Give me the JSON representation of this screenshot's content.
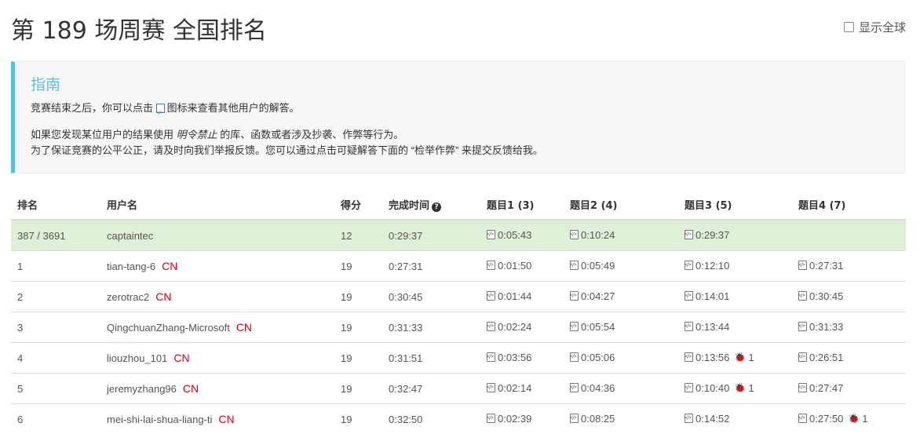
{
  "page": {
    "title": "第 189 场周赛 全国排名",
    "show_global_label": "显示全球"
  },
  "guide": {
    "heading": "指南",
    "line1_pre": "竞赛结束之后，你可以点击",
    "line1_post": "图标来查看其他用户的解答。",
    "line2_pre": "如果您发现某位用户的结果使用",
    "line2_em": "明令禁止",
    "line2_post": "的库、函数或者涉及抄袭、作弊等行为。",
    "line3": "为了保证竞赛的公平公正，请及时向我们举报反馈。您可以通过点击可疑解答下面的 “检举作弊” 来提交反馈给我。"
  },
  "table": {
    "headers": {
      "rank": "排名",
      "username": "用户名",
      "score": "得分",
      "finish_time": "完成时间",
      "q1": "题目1 (3)",
      "q2": "题目2 (4)",
      "q3": "题目3 (5)",
      "q4": "题目4 (7)"
    },
    "rows": [
      {
        "rank": "387 / 3691",
        "user": "captaintec",
        "cn": "",
        "score": "12",
        "time": "0:29:37",
        "q1": "0:05:43",
        "q2": "0:10:24",
        "q3": "0:29:37",
        "q3_bug": "",
        "q4": "",
        "q4_bug": ""
      },
      {
        "rank": "1",
        "user": "tian-tang-6",
        "cn": "CN",
        "score": "19",
        "time": "0:27:31",
        "q1": "0:01:50",
        "q2": "0:05:49",
        "q3": "0:12:10",
        "q3_bug": "",
        "q4": "0:27:31",
        "q4_bug": ""
      },
      {
        "rank": "2",
        "user": "zerotrac2",
        "cn": "CN",
        "score": "19",
        "time": "0:30:45",
        "q1": "0:01:44",
        "q2": "0:04:27",
        "q3": "0:14:01",
        "q3_bug": "",
        "q4": "0:30:45",
        "q4_bug": ""
      },
      {
        "rank": "3",
        "user": "QingchuanZhang-Microsoft",
        "cn": "CN",
        "score": "19",
        "time": "0:31:33",
        "q1": "0:02:24",
        "q2": "0:05:54",
        "q3": "0:13:44",
        "q3_bug": "",
        "q4": "0:31:33",
        "q4_bug": ""
      },
      {
        "rank": "4",
        "user": "liouzhou_101",
        "cn": "CN",
        "score": "19",
        "time": "0:31:51",
        "q1": "0:03:56",
        "q2": "0:05:06",
        "q3": "0:13:56",
        "q3_bug": "1",
        "q4": "0:26:51",
        "q4_bug": ""
      },
      {
        "rank": "5",
        "user": "jeremyzhang96",
        "cn": "CN",
        "score": "19",
        "time": "0:32:47",
        "q1": "0:02:14",
        "q2": "0:04:36",
        "q3": "0:10:40",
        "q3_bug": "1",
        "q4": "0:27:47",
        "q4_bug": ""
      },
      {
        "rank": "6",
        "user": "mei-shi-lai-shua-liang-ti",
        "cn": "CN",
        "score": "19",
        "time": "0:32:50",
        "q1": "0:02:39",
        "q2": "0:08:25",
        "q3": "0:14:52",
        "q3_bug": "",
        "q4": "0:27:50",
        "q4_bug": "1"
      }
    ]
  },
  "colors": {
    "accent": "#5bc0de",
    "highlight_row": "#dff0d8",
    "cn_badge": "#d9001b",
    "bug": "#c9302c"
  }
}
